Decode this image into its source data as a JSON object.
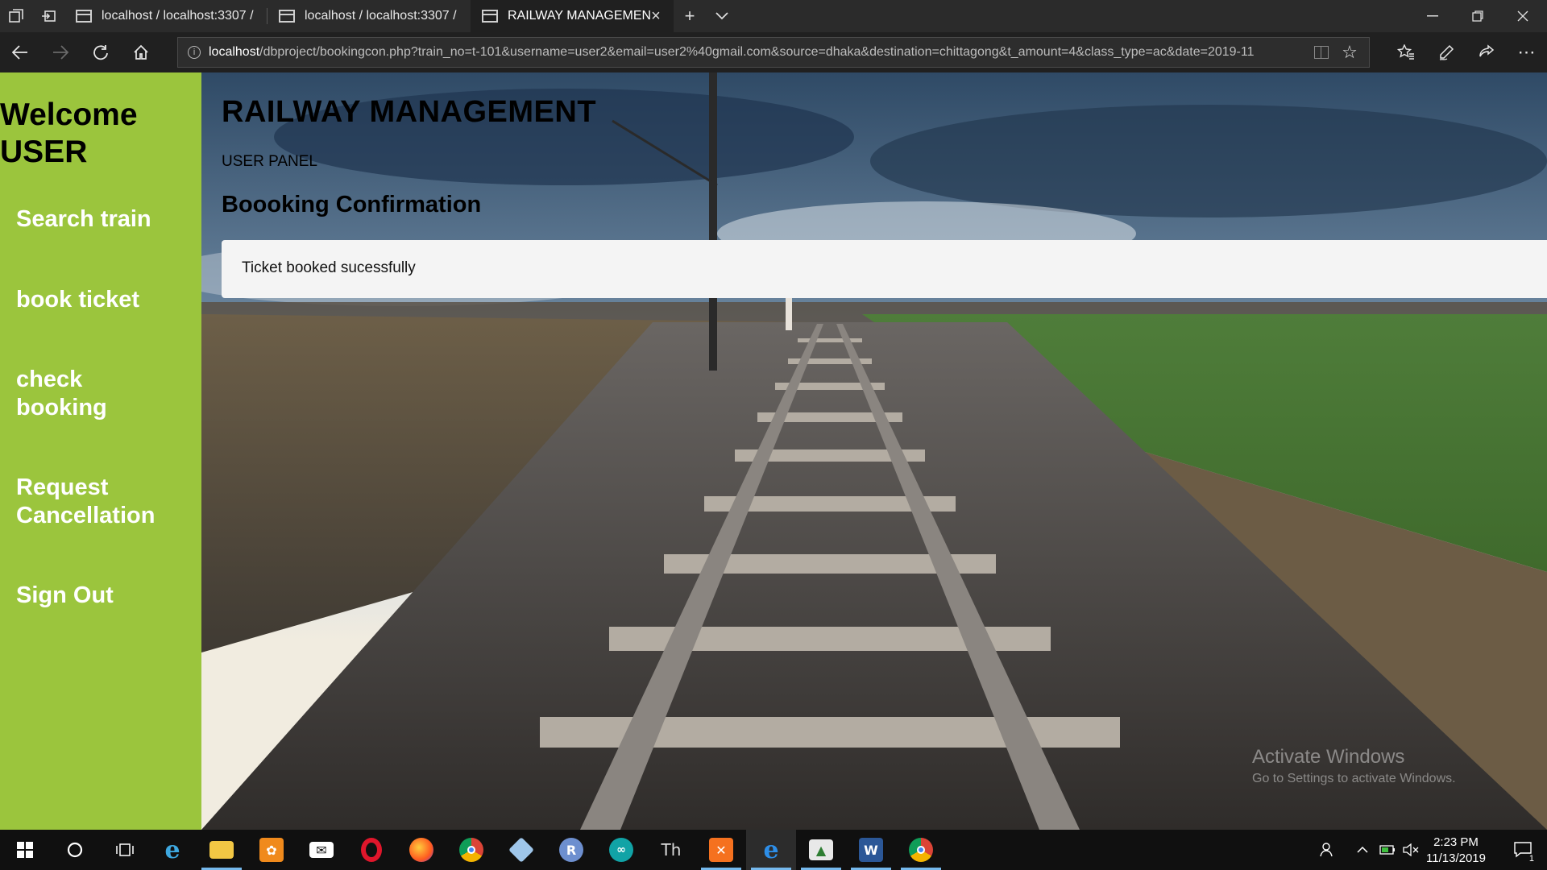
{
  "browser": {
    "tabs": [
      {
        "label": "localhost / localhost:3307 /",
        "active": false
      },
      {
        "label": "localhost / localhost:3307 /",
        "active": false
      },
      {
        "label": "RAILWAY MANAGEMEN",
        "active": true
      }
    ],
    "address": {
      "host": "localhost",
      "rest": "/dbproject/bookingcon.php?train_no=t-101&username=user2&email=user2%40gmail.com&source=dhaka&destination=chittagong&t_amount=4&class_type=ac&date=2019-11"
    }
  },
  "sidebar": {
    "welcome_line1": "Welcome",
    "welcome_line2": "USER",
    "links": [
      {
        "label": "Search train"
      },
      {
        "label": "book ticket"
      },
      {
        "label": "check booking"
      },
      {
        "label": "Request Cancellation"
      },
      {
        "label": "Sign Out"
      }
    ]
  },
  "main": {
    "title": "RAILWAY MANAGEMENT",
    "panel": "USER PANEL",
    "section_title": "Boooking Confirmation",
    "message": "Ticket booked sucessfully"
  },
  "watermark": {
    "title": "Activate Windows",
    "subtitle": "Go to Settings to activate Windows."
  },
  "taskbar": {
    "time": "2:23 PM",
    "date": "11/13/2019",
    "notification_count": "1"
  },
  "colors": {
    "sidebar_bg": "#9bc53d",
    "message_bg": "#f4f4f4",
    "chrome_bg": "#2b2b2b",
    "taskbar_accent": "#76b9ed"
  }
}
